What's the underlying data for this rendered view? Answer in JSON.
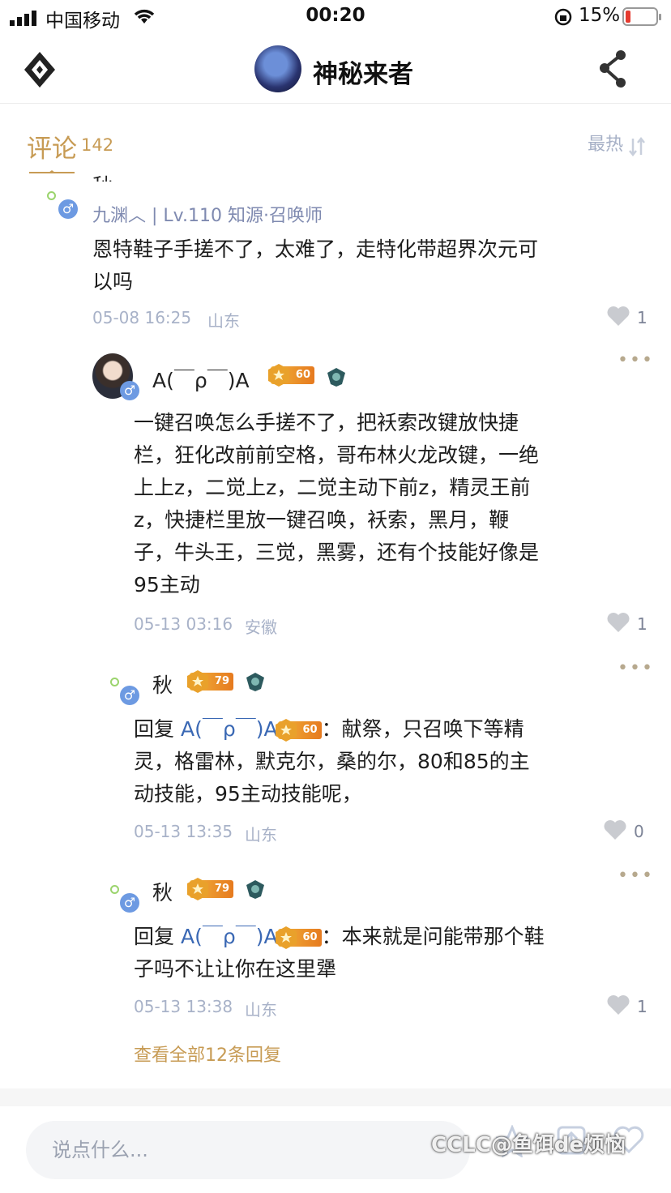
{
  "status_bar": {
    "carrier": "中国移动",
    "time": "00:20",
    "battery": "15%"
  },
  "header": {
    "title": "神秘来者"
  },
  "section": {
    "title": "评论",
    "count": "142",
    "sort": "最热"
  },
  "top_comment": {
    "name_partial": "秋",
    "meta": "九渊︿ | Lv.110 知源·召唤师",
    "body_lines": [
      "恩特鞋子手搓不了，太难了，走特化带超界次元可",
      "以吗"
    ],
    "time": "05-08 16:25",
    "location": "山东",
    "likes": "1"
  },
  "reply1": {
    "name": "A(￣ρ￣)A",
    "level": "60",
    "body_lines": [
      "一键召唤怎么手搓不了，把袄索改键放快捷",
      "栏，狂化改前前空格，哥布林火龙改键，一绝",
      "上上z，二觉上z，二觉主动下前z，精灵王前",
      "z，快捷栏里放一键召唤，袄索，黑月，鞭",
      "子，牛头王，三觉，黑雾，还有个技能好像是",
      "95主动"
    ],
    "time": "05-13 03:16",
    "location": "安徽",
    "likes": "1"
  },
  "reply2": {
    "name": "秋",
    "level": "79",
    "prefix": "回复",
    "mention": "A(￣ρ￣)A",
    "mention_level": "60",
    "line1_rest": "：献祭，只召唤下等精",
    "body_lines": [
      "灵，格雷林，默克尔，桑的尔，80和85的主",
      "动技能，95主动技能呢，"
    ],
    "time": "05-13 13:35",
    "location": "山东",
    "likes": "0"
  },
  "reply3": {
    "name": "秋",
    "level": "79",
    "prefix": "回复",
    "mention": "A(￣ρ￣)A",
    "mention_level": "60",
    "line1_rest": "：本来就是问能带那个鞋",
    "body_lines": [
      "子吗不让让你在这里犟"
    ],
    "time": "05-13 13:38",
    "location": "山东",
    "likes": "1"
  },
  "view_all": "查看全部12条回复",
  "input": {
    "placeholder": "说点什么..."
  },
  "watermark": "CCLC@鱼饵de烦恼",
  "colors": {
    "accent": "#c79b54",
    "mention": "#3a68b4",
    "meta": "#7f8ab0"
  },
  "icons": [
    "signal-icon",
    "wifi-icon",
    "lock-rotation-icon",
    "battery-icon",
    "back-diamond-icon",
    "share-icon",
    "sort-icon",
    "heart-icon",
    "more-icon",
    "star-icon",
    "upload-icon"
  ]
}
